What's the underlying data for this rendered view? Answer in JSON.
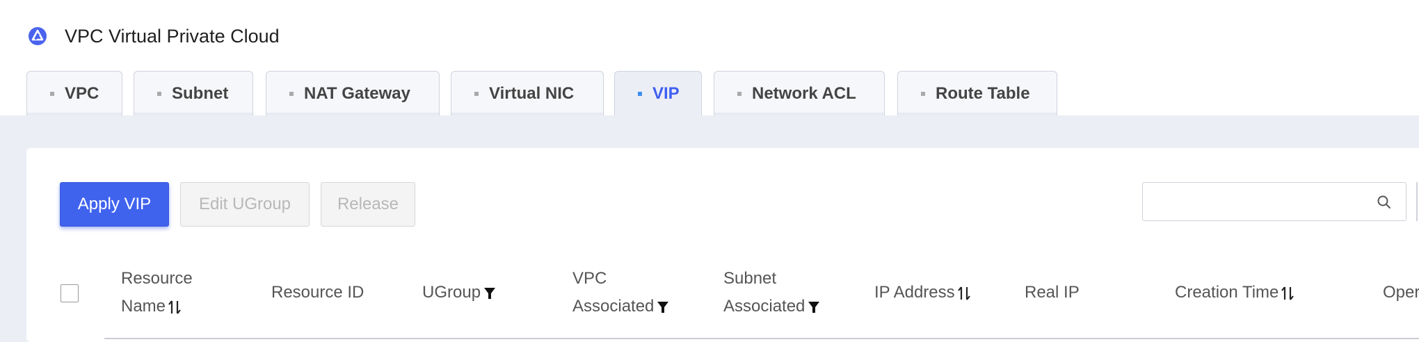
{
  "page": {
    "title": "VPC Virtual Private Cloud"
  },
  "tabs": [
    {
      "label": "VPC",
      "active": false
    },
    {
      "label": "Subnet",
      "active": false
    },
    {
      "label": "NAT Gateway",
      "active": false
    },
    {
      "label": "Virtual NIC",
      "active": false
    },
    {
      "label": "VIP",
      "active": true
    },
    {
      "label": "Network ACL",
      "active": false
    },
    {
      "label": "Route Table",
      "active": false
    }
  ],
  "toolbar": {
    "apply_label": "Apply VIP",
    "edit_ugroup_label": "Edit UGroup",
    "release_label": "Release",
    "search_placeholder": ""
  },
  "table": {
    "columns": {
      "resource_name_l1": "Resource",
      "resource_name_l2": "Name",
      "resource_id": "Resource ID",
      "ugroup": "UGroup",
      "vpc_assoc_l1": "VPC",
      "vpc_assoc_l2": "Associated",
      "subnet_assoc_l1": "Subnet",
      "subnet_assoc_l2": "Associated",
      "ip_address": "IP Address",
      "real_ip": "Real IP",
      "creation_time": "Creation Time",
      "operation": "Oper"
    }
  },
  "colors": {
    "accent": "#4063ee",
    "active_tab_text": "#3e5ff0",
    "page_bg": "#eceef6"
  },
  "icons": {
    "logo": "vpc-logo-icon",
    "sort": "sort-icon",
    "filter": "filter-icon",
    "search": "search-icon"
  }
}
